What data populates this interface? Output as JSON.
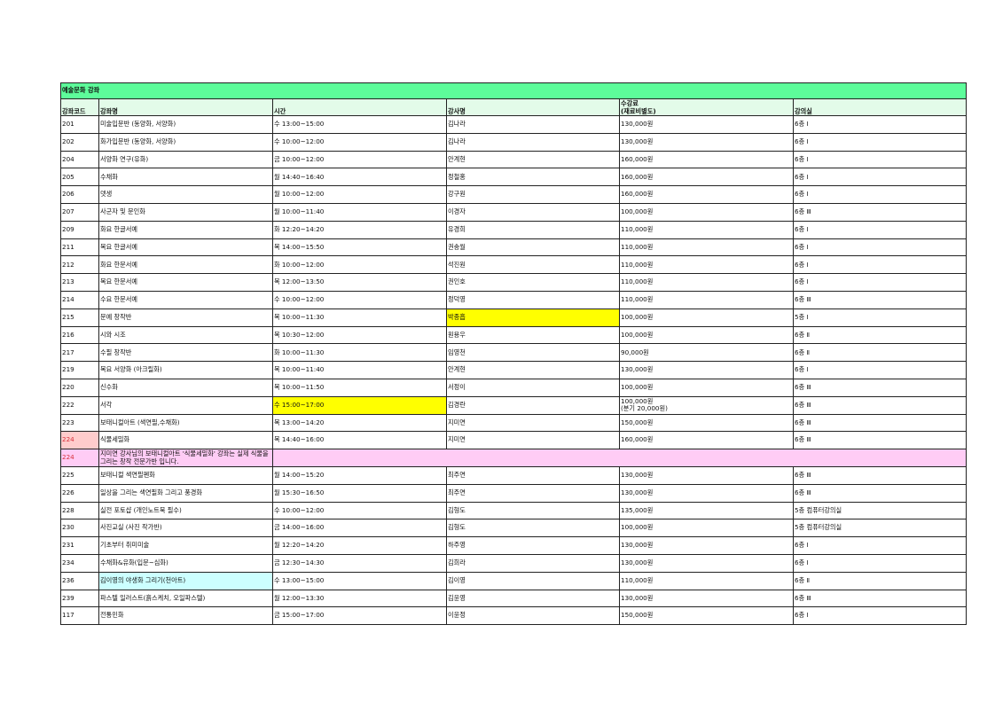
{
  "title": "예술문화 강좌",
  "headers": {
    "code": "강좌코드",
    "name": "강좌명",
    "time": "시간",
    "teacher": "강사명",
    "fee_line1": "수강료",
    "fee_line2": "(재료비별도)",
    "room": "강의실"
  },
  "rows": [
    {
      "code": "201",
      "name": "미술입문반 (동양화, 서양화)",
      "time": "수 13:00~15:00",
      "teacher": "김나라",
      "fee": "130,000원",
      "room": "6층 Ⅰ"
    },
    {
      "code": "202",
      "name": "화가입문반 (동양화, 서양화)",
      "time": "수 10:00~12:00",
      "teacher": "김나라",
      "fee": "130,000원",
      "room": "6층 Ⅰ"
    },
    {
      "code": "204",
      "name": "서양화 연구(유화)",
      "time": "금 10:00~12:00",
      "teacher": "안계현",
      "fee": "160,000원",
      "room": "6층 Ⅰ"
    },
    {
      "code": "205",
      "name": "수채화",
      "time": "월 14:40~16:40",
      "teacher": "정철홍",
      "fee": "160,000원",
      "room": "6층 Ⅰ"
    },
    {
      "code": "206",
      "name": "뎃생",
      "time": "월 10:00~12:00",
      "teacher": "강구원",
      "fee": "160,000원",
      "room": "6층 Ⅰ"
    },
    {
      "code": "207",
      "name": "사군자 및 문인화",
      "time": "월 10:00~11:40",
      "teacher": "이경자",
      "fee": "100,000원",
      "room": "6층 Ⅲ"
    },
    {
      "code": "209",
      "name": "화요 한글서예",
      "time": "화 12:20~14:20",
      "teacher": "유경희",
      "fee": "110,000원",
      "room": "6층 Ⅰ"
    },
    {
      "code": "211",
      "name": "목요 한글서예",
      "time": "목 14:00~15:50",
      "teacher": "권송월",
      "fee": "110,000원",
      "room": "6층 Ⅰ"
    },
    {
      "code": "212",
      "name": "화요 한문서예",
      "time": "화 10:00~12:00",
      "teacher": "석진원",
      "fee": "110,000원",
      "room": "6층 Ⅰ"
    },
    {
      "code": "213",
      "name": "목요 한문서예",
      "time": "목 12:00~13:50",
      "teacher": "권인호",
      "fee": "110,000원",
      "room": "6층 Ⅰ"
    },
    {
      "code": "214",
      "name": "수요 한문서예",
      "time": "수 10:00~12:00",
      "teacher": "정덕영",
      "fee": "110,000원",
      "room": "6층 Ⅲ"
    },
    {
      "code": "215",
      "name": "문예 창작반",
      "time": "목 10:00~11:30",
      "teacher": "박종흡",
      "fee": "100,000원",
      "room": "5층 Ⅰ",
      "hl_teacher": "yellow"
    },
    {
      "code": "216",
      "name": "시와 시조",
      "time": "목 10:30~12:00",
      "teacher": "원용우",
      "fee": "100,000원",
      "room": "6층 Ⅱ"
    },
    {
      "code": "217",
      "name": "수필 창작반",
      "time": "화 10:00~11:30",
      "teacher": "임영천",
      "fee": "90,000원",
      "room": "6층 Ⅱ"
    },
    {
      "code": "219",
      "name": "목요 서양화 (아크릴화)",
      "time": "목 10:00~11:40",
      "teacher": "안계현",
      "fee": "130,000원",
      "room": "6층 Ⅰ"
    },
    {
      "code": "220",
      "name": "신수화",
      "time": "목 10:00~11:50",
      "teacher": "서정이",
      "fee": "100,000원",
      "room": "6층 Ⅲ"
    },
    {
      "code": "222",
      "name": "서각",
      "time": "수 15:00~17:00",
      "teacher": "김경란",
      "fee": "100,000원",
      "fee_note": "(분기 20,000원)",
      "room": "6층 Ⅲ",
      "hl_time": "yellow"
    },
    {
      "code": "223",
      "name": "보태니컬아트 (색연필,수채화)",
      "time": "목 13:00~14:20",
      "teacher": "지미연",
      "fee": "150,000원",
      "room": "6층 Ⅲ"
    },
    {
      "code": "224",
      "name": "식물세밀화",
      "time": "목 14:40~16:00",
      "teacher": "지미연",
      "fee": "160,000원",
      "room": "6층 Ⅲ",
      "hl_code": "pink"
    }
  ],
  "note_row": {
    "code": "224",
    "text": "지미연 강사님의 보태니컬아트 '식물세밀화' 강좌는 실제 식물을 그리는 창작 전문가반 입니다."
  },
  "rows2": [
    {
      "code": "225",
      "name": "보태니컬 색연필펜화",
      "time": "월 14:00~15:20",
      "teacher": "최주연",
      "fee": "130,000원",
      "room": "6층 Ⅲ"
    },
    {
      "code": "226",
      "name": "일상을 그리는 색연필화 그리고 풍경화",
      "time": "월 15:30~16:50",
      "teacher": "최주연",
      "fee": "130,000원",
      "room": "6층 Ⅲ"
    },
    {
      "code": "228",
      "name": "실전 포토샵 (개인노트북 필수)",
      "time": "수 10:00~12:00",
      "teacher": "김형도",
      "fee": "135,000원",
      "room": "5층 컴퓨터강의실"
    },
    {
      "code": "230",
      "name": "사진교실 (사진 작가반)",
      "time": "금 14:00~16:00",
      "teacher": "김형도",
      "fee": "100,000원",
      "room": "5층 컴퓨터강의실"
    },
    {
      "code": "231",
      "name": "기초부터 취미미술",
      "time": "월 12:20~14:20",
      "teacher": "하주영",
      "fee": "130,000원",
      "room": "6층 Ⅰ"
    },
    {
      "code": "234",
      "name": "수채화&유화(입문~심화)",
      "time": "금 12:30~14:30",
      "teacher": "김희라",
      "fee": "130,000원",
      "room": "6층 Ⅰ"
    },
    {
      "code": "236",
      "name": "김이영의 야생화 그리기(천아트)",
      "time": "수 13:00~15:00",
      "teacher": "김이영",
      "fee": "110,000원",
      "room": "6층 Ⅱ",
      "hl_name": "cyan"
    },
    {
      "code": "239",
      "name": "파스텔 일러스트(흙스케치, 오일파스텔)",
      "time": "월 12:00~13:30",
      "teacher": "김윤영",
      "fee": "130,000원",
      "room": "6층 Ⅲ"
    },
    {
      "code": "117",
      "name": "전통민화",
      "time": "금 15:00~17:00",
      "teacher": "이윤정",
      "fee": "150,000원",
      "room": "6층 Ⅰ"
    }
  ],
  "colors": {
    "title_bg": "#5dfc9a",
    "header_bg": "#e3fbe9",
    "highlight_yellow": "#ffff00",
    "highlight_pink": "#ffcccc",
    "highlight_cyan": "#ccffff",
    "note_row_bg": "#ffccf5"
  }
}
